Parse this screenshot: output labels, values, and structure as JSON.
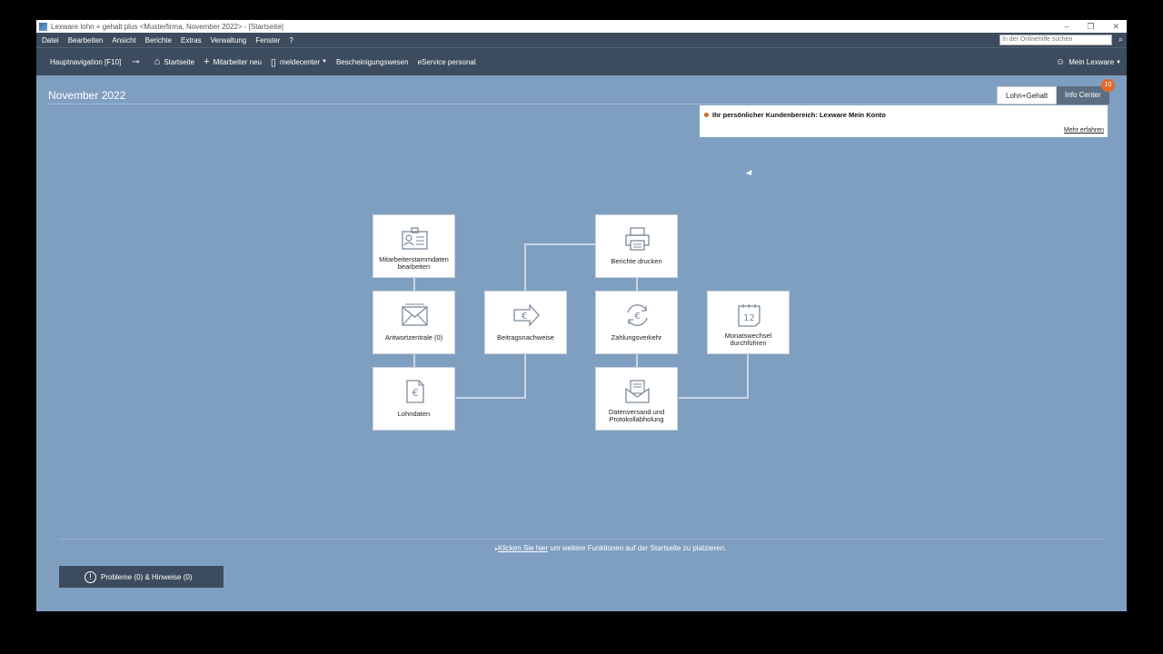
{
  "window": {
    "title": "Lexware lohn + gehalt plus <Musterfirma, November 2022> - [Startseite]",
    "controls": [
      "–",
      "❐",
      "✕"
    ]
  },
  "menu": [
    "Datei",
    "Bearbeiten",
    "Ansicht",
    "Berichte",
    "Extras",
    "Verwaltung",
    "Fenster",
    "?"
  ],
  "help_search": {
    "placeholder": "In der Onlinehilfe suchen"
  },
  "toolbar": {
    "nav": "Hauptnavigation [F10]",
    "startseite": "Startseite",
    "mitarbeiter_neu": "Mitarbeiter neu",
    "meldecenter": "meldecenter",
    "bescheinigungswesen": "Bescheinigungswesen",
    "eservice": "eService personal",
    "mein_lexware": "Mein Lexware"
  },
  "page": {
    "title": "November 2022"
  },
  "tabs": {
    "lohn": "Lohn+Gehalt",
    "info": "Info Center",
    "badge": "10"
  },
  "info_panel": {
    "text": "Ihr persönlicher Kundenbereich: Lexware Mein Konto",
    "more": "Mehr erfahren"
  },
  "tiles": {
    "stammdaten": "Mitarbeiterstammdaten bearbeiten",
    "antwort": "Antwortzentrale (0)",
    "lohndaten": "Lohndaten",
    "beitrag": "Beitragsnachweise",
    "berichte": "Berichte drucken",
    "zahlung": "Zahlungsverkehr",
    "datenversand": "Datenversand und Protokollabholung",
    "monatswechsel": "Monatswechsel durchführen"
  },
  "footer": {
    "link": "Klicken Sie hier",
    "hint": " um weitere Funktionen auf der Startseite zu platzieren.",
    "problems": "Probleme (0) & Hinweise (0)"
  },
  "colors": {
    "background": "#7f9fc1",
    "bars": "#3c4c5e",
    "badge": "#e46a2b"
  }
}
